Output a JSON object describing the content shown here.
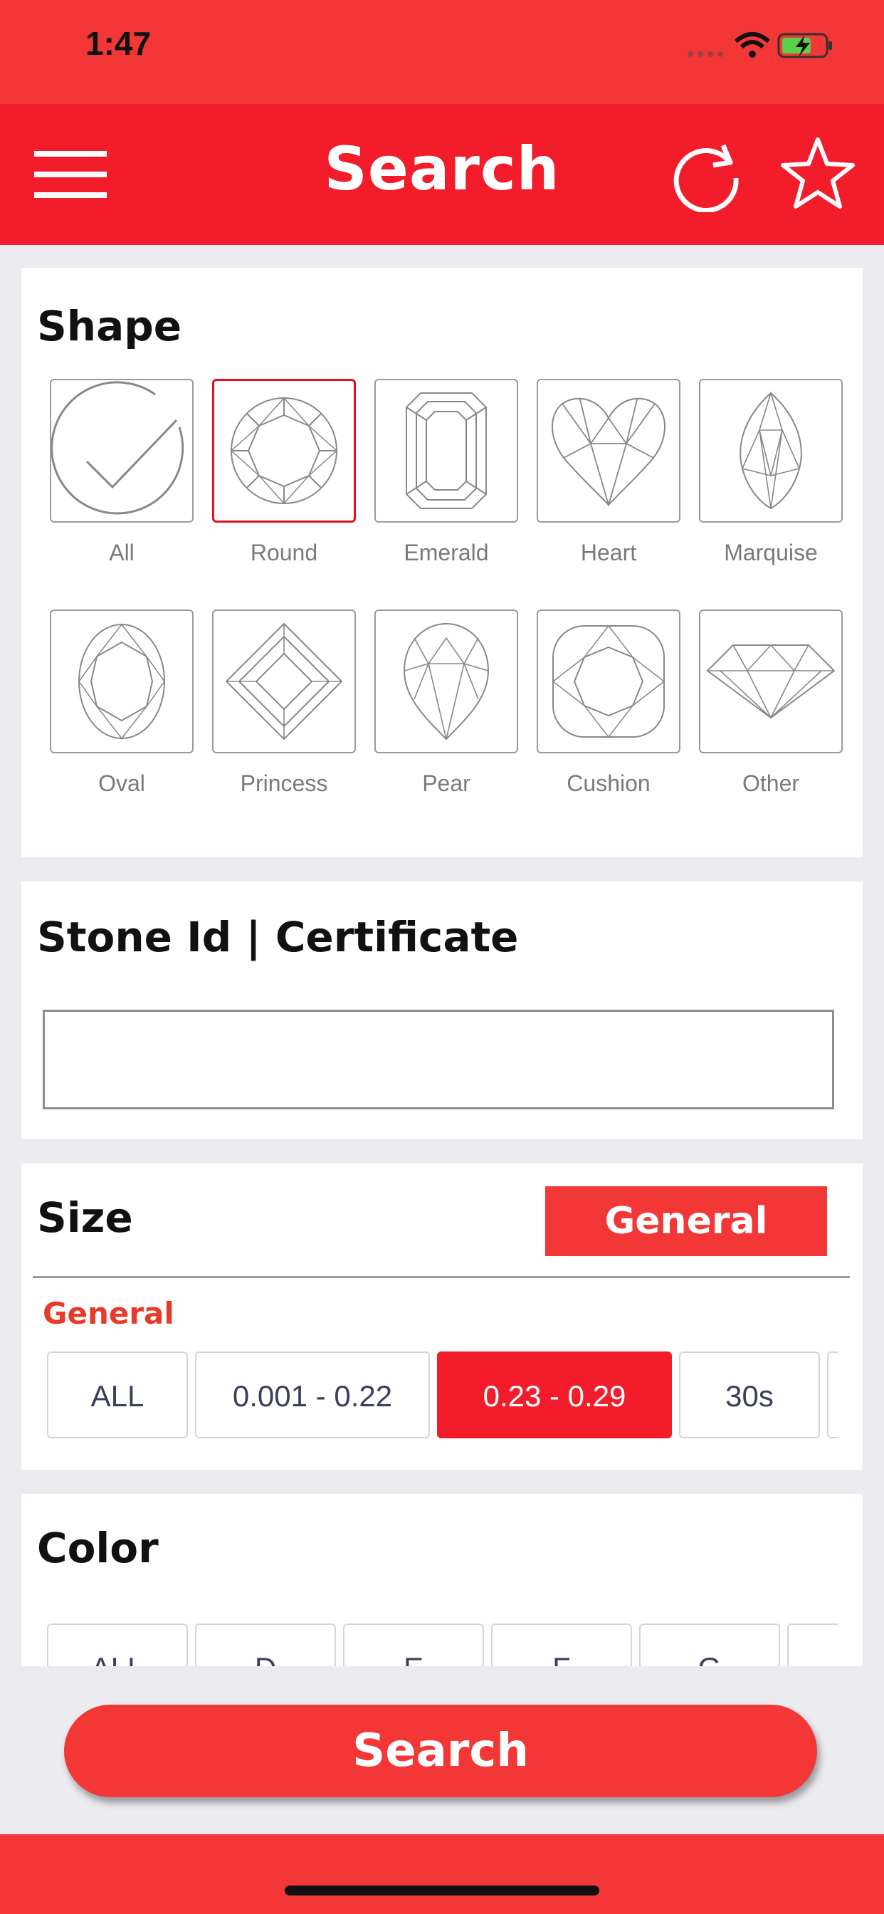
{
  "status_bar": {
    "time": "1:47"
  },
  "nav": {
    "title": "Search",
    "icons": [
      "menu-icon",
      "refresh-icon",
      "star-icon"
    ]
  },
  "shape_section": {
    "title": "Shape",
    "shapes": [
      {
        "label": "All",
        "icon": "checkmark-circle-icon",
        "selected": false
      },
      {
        "label": "Round",
        "icon": "round-diamond-icon",
        "selected": true
      },
      {
        "label": "Emerald",
        "icon": "emerald-diamond-icon",
        "selected": false
      },
      {
        "label": "Heart",
        "icon": "heart-diamond-icon",
        "selected": false
      },
      {
        "label": "Marquise",
        "icon": "marquise-diamond-icon",
        "selected": false
      },
      {
        "label": "Oval",
        "icon": "oval-diamond-icon",
        "selected": false
      },
      {
        "label": "Princess",
        "icon": "princess-diamond-icon",
        "selected": false
      },
      {
        "label": "Pear",
        "icon": "pear-diamond-icon",
        "selected": false
      },
      {
        "label": "Cushion",
        "icon": "cushion-diamond-icon",
        "selected": false
      },
      {
        "label": "Other",
        "icon": "other-diamond-icon",
        "selected": false
      }
    ]
  },
  "stone_section": {
    "title": "Stone Id | Certificate",
    "input_value": "",
    "placeholder": ""
  },
  "size_section": {
    "title": "Size",
    "type_button": "General",
    "subheading": "General",
    "chips": [
      {
        "label": "ALL",
        "selected": false
      },
      {
        "label": "0.001 - 0.22",
        "selected": false
      },
      {
        "label": "0.23 - 0.29",
        "selected": true
      },
      {
        "label": "30s",
        "selected": false
      }
    ]
  },
  "color_section": {
    "title": "Color",
    "chips": [
      "ALL",
      "D",
      "E",
      "F",
      "G"
    ]
  },
  "search_button": "Search",
  "colors": {
    "primary_red": "#f21c2b",
    "accent_red": "#f33737",
    "subheading_red": "#e83a2a"
  }
}
